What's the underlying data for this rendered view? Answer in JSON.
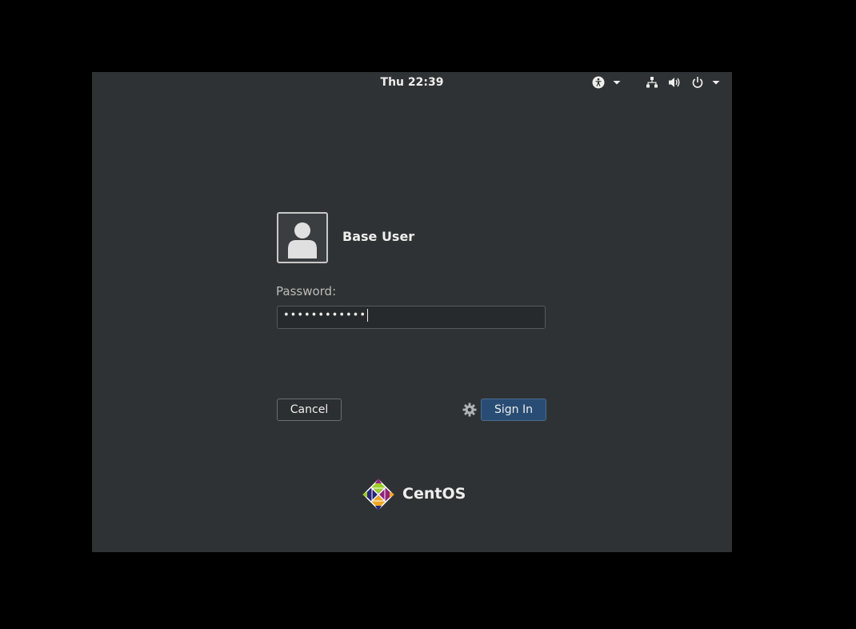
{
  "topbar": {
    "clock": "Thu 22:39",
    "icons": [
      "accessibility-icon",
      "dropdown-arrow-icon",
      "network-icon",
      "volume-icon",
      "power-icon",
      "dropdown-arrow-icon"
    ]
  },
  "login": {
    "user_name": "Base User",
    "password_label": "Password:",
    "password_value": "••••••••••••",
    "cancel_label": "Cancel",
    "signin_label": "Sign In",
    "session_icon": "gear-icon"
  },
  "branding": {
    "logo_text": "CentOS"
  },
  "colors": {
    "background": "#2f3234",
    "signin_button": "#284c73",
    "text": "#eeeeec"
  }
}
